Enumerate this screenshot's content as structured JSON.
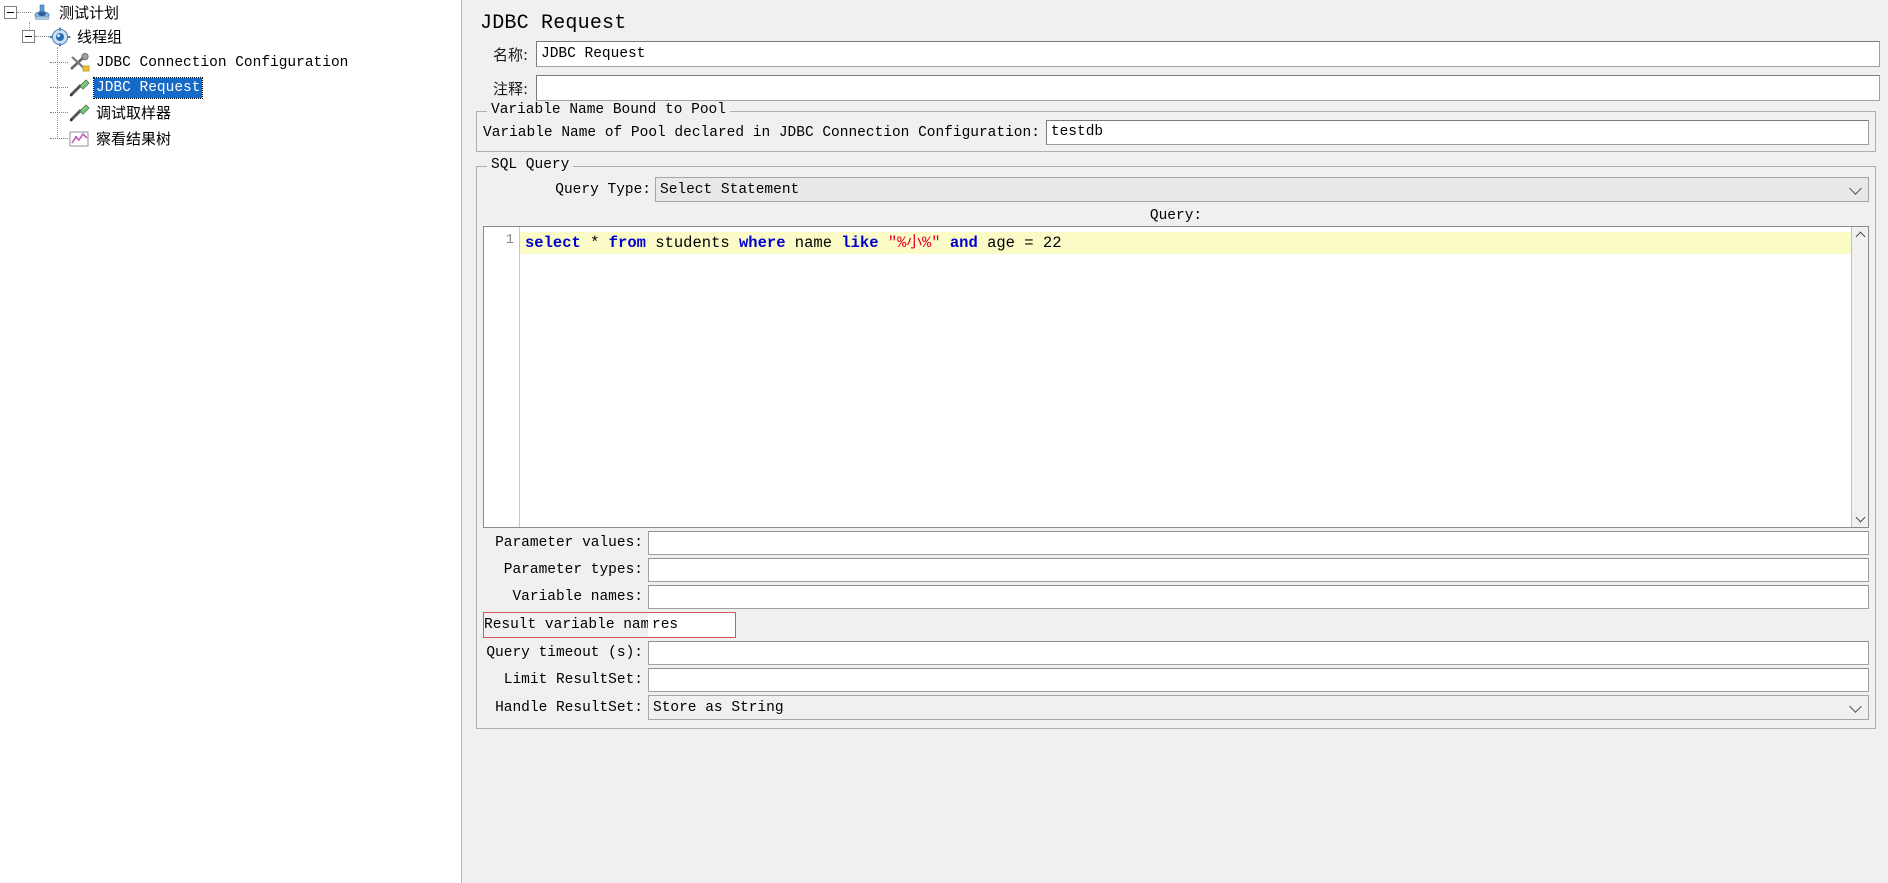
{
  "tree": {
    "items": [
      {
        "label": "测试计划",
        "icon": "test-plan-icon",
        "level": 0,
        "selected": false,
        "script": "cjk"
      },
      {
        "label": "线程组",
        "icon": "thread-group-icon",
        "level": 1,
        "selected": false,
        "script": "cjk"
      },
      {
        "label": "JDBC Connection Configuration",
        "icon": "config-element-icon",
        "level": 2,
        "selected": false,
        "script": "mono"
      },
      {
        "label": "JDBC Request",
        "icon": "sampler-icon",
        "level": 2,
        "selected": true,
        "script": "mono"
      },
      {
        "label": "调试取样器",
        "icon": "sampler-icon",
        "level": 2,
        "selected": false,
        "script": "cjk"
      },
      {
        "label": "察看结果树",
        "icon": "listener-icon",
        "level": 2,
        "selected": false,
        "script": "cjk"
      }
    ]
  },
  "panel": {
    "title": "JDBC Request",
    "name_label": "名称:",
    "name_value": "JDBC Request",
    "comment_label": "注释:",
    "comment_value": ""
  },
  "pool_group": {
    "title": "Variable Name Bound to Pool",
    "label": "Variable Name of Pool declared in JDBC Connection Configuration:",
    "value": "testdb"
  },
  "sql_group": {
    "title": "SQL Query",
    "query_type_label": "Query Type:",
    "query_type_value": "Select Statement",
    "query_caption": "Query:",
    "line_number": "1",
    "sql_tokens": [
      {
        "t": "select",
        "c": "kw"
      },
      {
        "t": " ",
        "c": "pl"
      },
      {
        "t": "*",
        "c": "op"
      },
      {
        "t": " ",
        "c": "pl"
      },
      {
        "t": "from",
        "c": "kw"
      },
      {
        "t": " students ",
        "c": "pl"
      },
      {
        "t": "where",
        "c": "kw"
      },
      {
        "t": " name ",
        "c": "pl"
      },
      {
        "t": "like",
        "c": "kw"
      },
      {
        "t": " ",
        "c": "pl"
      },
      {
        "t": "\"%小%\"",
        "c": "str"
      },
      {
        "t": " ",
        "c": "pl"
      },
      {
        "t": "and",
        "c": "kw"
      },
      {
        "t": " age ",
        "c": "pl"
      },
      {
        "t": "=",
        "c": "op"
      },
      {
        "t": " 22",
        "c": "pl"
      }
    ],
    "sql_plain": "select * from students where name like \"%小%\" and age = 22"
  },
  "params": [
    {
      "label": "Parameter values:",
      "value": "",
      "highlight": false
    },
    {
      "label": "Parameter types:",
      "value": "",
      "highlight": false
    },
    {
      "label": "Variable names:",
      "value": "",
      "highlight": false
    },
    {
      "label": "Result variable name:",
      "value": "res",
      "highlight": true
    },
    {
      "label": "Query timeout (s):",
      "value": "",
      "highlight": false
    },
    {
      "label": "Limit ResultSet:",
      "value": "",
      "highlight": false
    }
  ],
  "handle_resultset": {
    "label": "Handle ResultSet:",
    "value": "Store as String"
  },
  "colors": {
    "selection": "#1569c7",
    "sql_keyword": "#0000cd",
    "sql_string": "#e8002d",
    "editor_line_bg": "#fbfbc8",
    "highlight_border": "#d45a5a",
    "panel_bg": "#f0f0f0"
  }
}
